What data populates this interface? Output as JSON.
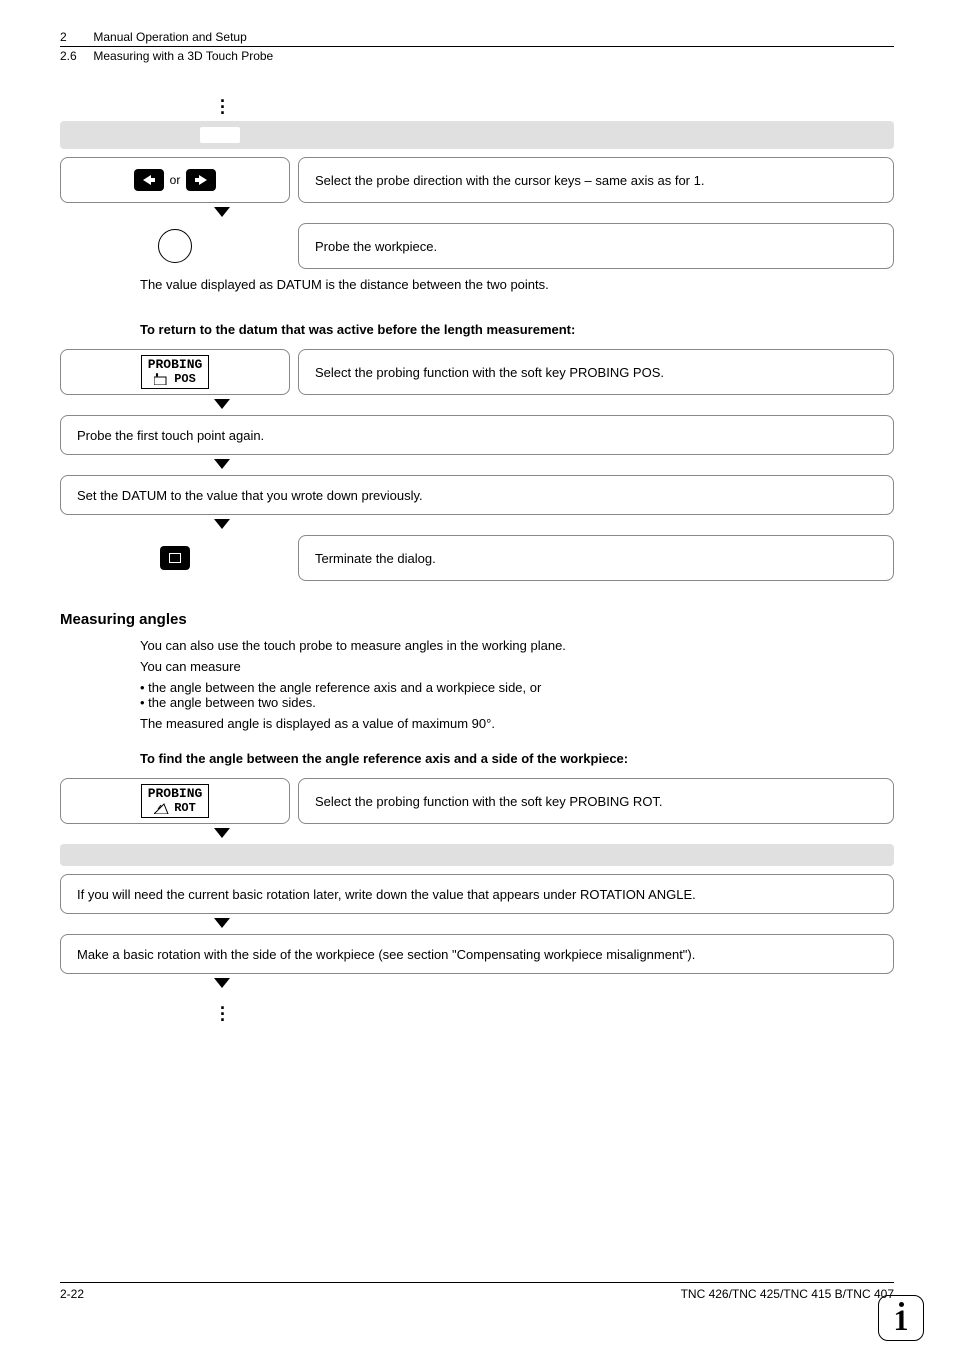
{
  "header": {
    "chapter_num": "2",
    "chapter_title": "Manual Operation and Setup",
    "section_num": "2.6",
    "section_title": "Measuring with a 3D Touch Probe"
  },
  "step_or": "or",
  "step1_desc": "Select the probe direction with the cursor keys – same axis as for 1.",
  "step2_desc": "Probe the workpiece.",
  "datum_note": "The value displayed as DATUM is the distance between the two points.",
  "return_heading": "To return to the datum that was active before the length measurement:",
  "softkey_pos_line1": "PROBING",
  "softkey_pos_line2": "POS",
  "return_step1_desc": "Select the probing function with the soft key PROBING POS.",
  "return_step2": "Probe the first touch point again.",
  "return_step3": "Set the DATUM to the value that you wrote down previously.",
  "return_step4_desc": "Terminate the dialog.",
  "angles_heading": "Measuring angles",
  "angles_intro1": "You can also use the touch probe to measure angles in the working plane.",
  "angles_intro2": "You can measure",
  "angles_bullet1": "the angle between the angle reference axis and a workpiece side, or",
  "angles_bullet2": "the angle between two sides.",
  "angles_note": "The measured angle is displayed as a value of maximum 90°.",
  "angles_find_heading": "To find the angle between the angle reference axis and a side of the workpiece:",
  "softkey_rot_line1": "PROBING",
  "softkey_rot_line2": "ROT",
  "angles_step1_desc": "Select the probing function with the soft key PROBING ROT.",
  "angles_step2": "If you will need the current basic rotation later, write down the value that appears under ROTATION ANGLE.",
  "angles_step3": "Make a basic rotation with the side of the workpiece (see section \"Compensating workpiece misalignment\").",
  "footer": {
    "page": "2-22",
    "doc": "TNC 426/TNC 425/TNC 415 B/TNC 407"
  }
}
